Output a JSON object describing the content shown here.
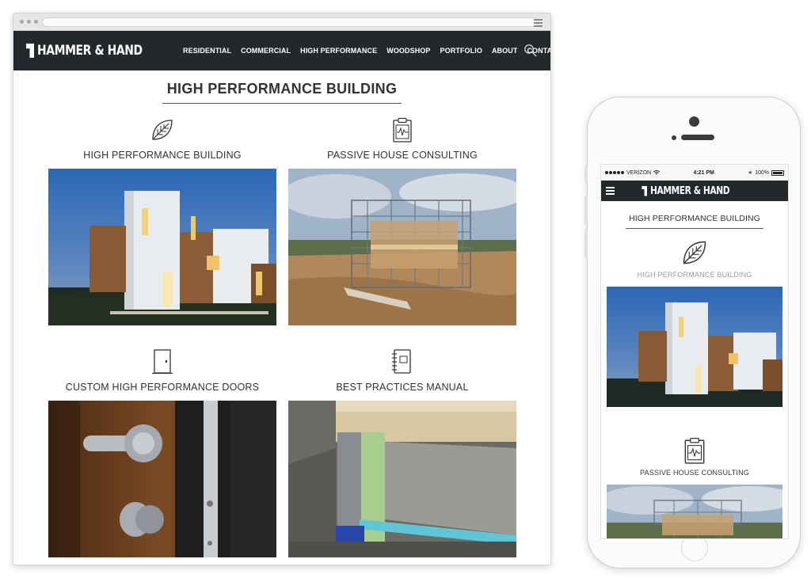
{
  "site": {
    "logo_text": "HAMMER & HAND",
    "nav": [
      {
        "label": "RESIDENTIAL"
      },
      {
        "label": "COMMERCIAL"
      },
      {
        "label": "HIGH PERFORMANCE"
      },
      {
        "label": "WOODSHOP"
      },
      {
        "label": "PORTFOLIO"
      },
      {
        "label": "ABOUT"
      },
      {
        "label": "CONTACT"
      }
    ],
    "page_title": "HIGH PERFORMANCE BUILDING"
  },
  "cards": [
    {
      "title": "HIGH PERFORMANCE BUILDING",
      "icon": "leaf-icon",
      "photo": "modern-house-dusk"
    },
    {
      "title": "PASSIVE HOUSE CONSULTING",
      "icon": "clipboard-chart-icon",
      "photo": "scaffolding-construction"
    },
    {
      "title": "CUSTOM HIGH PERFORMANCE DOORS",
      "icon": "door-icon",
      "photo": "door-lock-hardware"
    },
    {
      "title": "BEST PRACTICES MANUAL",
      "icon": "notebook-icon",
      "photo": "foundation-cross-section"
    }
  ],
  "mobile": {
    "status": {
      "carrier": "VERIZON",
      "time": "4:21 PM",
      "battery": "100%"
    },
    "page_title": "HIGH PERFORMANCE BUILDING",
    "items": [
      {
        "title": "HIGH PERFORMANCE BUILDING"
      },
      {
        "title": "PASSIVE HOUSE CONSULTING"
      }
    ]
  },
  "colors": {
    "nav_bg": "#23282b",
    "text": "#333333",
    "nav_text": "#ffffff"
  }
}
